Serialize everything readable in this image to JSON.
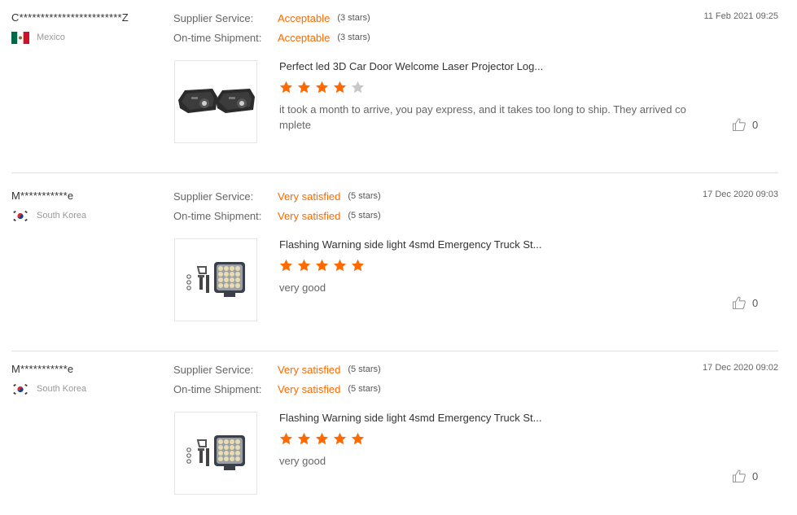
{
  "reviews": [
    {
      "name": "C************************Z",
      "country": "Mexico",
      "flag": "mexico",
      "supplier_label": "Supplier Service:",
      "supplier_value": "Acceptable",
      "supplier_stars": "(3 stars)",
      "shipment_label": "On-time Shipment:",
      "shipment_value": "Acceptable",
      "shipment_stars": "(3 stars)",
      "date": "11 Feb 2021 09:25",
      "product_title": "Perfect led 3D Car Door Welcome Laser Projector Log...",
      "product_image": "car-door-projector-thumbnail",
      "rating": 4,
      "comment": "it took a month to arrive, you pay express, and it takes too long to ship. They arrived complete",
      "likes": "0"
    },
    {
      "name": "M***********e",
      "country": "South Korea",
      "flag": "south-korea",
      "supplier_label": "Supplier Service:",
      "supplier_value": "Very satisfied",
      "supplier_stars": "(5 stars)",
      "shipment_label": "On-time Shipment:",
      "shipment_value": "Very satisfied",
      "shipment_stars": "(5 stars)",
      "date": "17 Dec 2020 09:03",
      "product_title": "Flashing Warning side light 4smd Emergency Truck St...",
      "product_image": "led-work-light-thumbnail",
      "rating": 5,
      "comment": "very good",
      "likes": "0"
    },
    {
      "name": "M***********e",
      "country": "South Korea",
      "flag": "south-korea",
      "supplier_label": "Supplier Service:",
      "supplier_value": "Very satisfied",
      "supplier_stars": "(5 stars)",
      "shipment_label": "On-time Shipment:",
      "shipment_value": "Very satisfied",
      "shipment_stars": "(5 stars)",
      "date": "17 Dec 2020 09:02",
      "product_title": "Flashing Warning side light 4smd Emergency Truck St...",
      "product_image": "led-work-light-thumbnail",
      "rating": 5,
      "comment": "very good",
      "likes": "0"
    }
  ],
  "colors": {
    "accent": "#ff6a00",
    "star_filled": "#ff6a00",
    "star_empty": "#c8c8c8"
  }
}
